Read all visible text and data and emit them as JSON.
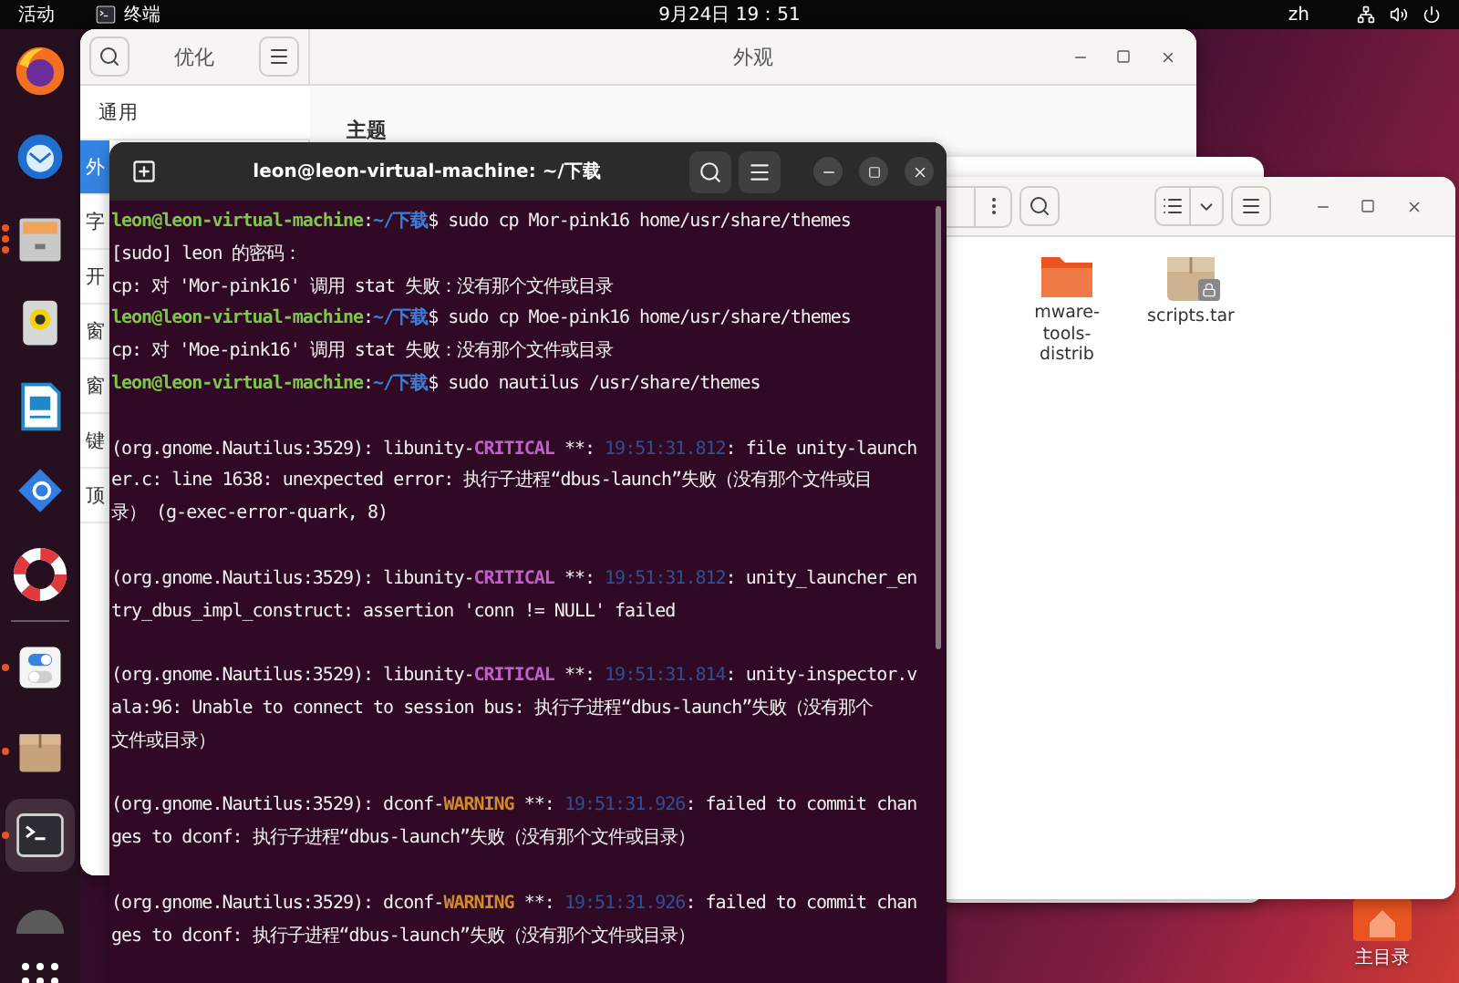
{
  "top_bar": {
    "activities": "活动",
    "app_menu": "终端",
    "clock": "9月24日 19：51",
    "input_method": "zh"
  },
  "dock": {
    "pinned": [
      {
        "kind": "browser",
        "running": false,
        "several_windows": false,
        "selected": false
      },
      {
        "kind": "mail",
        "running": false,
        "several_windows": false,
        "selected": false
      },
      {
        "kind": "files",
        "running": true,
        "several_windows": true,
        "selected": false
      },
      {
        "kind": "speaker",
        "running": false,
        "several_windows": false,
        "selected": false
      },
      {
        "kind": "document",
        "running": false,
        "several_windows": false,
        "selected": false
      },
      {
        "kind": "gear",
        "running": false,
        "several_windows": false,
        "selected": false
      },
      {
        "kind": "lifebuoy",
        "running": false,
        "several_windows": false,
        "selected": false
      }
    ],
    "running": [
      {
        "kind": "toggles",
        "running": true,
        "several_windows": false,
        "selected": false
      },
      {
        "kind": "package",
        "running": true,
        "several_windows": false,
        "selected": false
      },
      {
        "kind": "terminal",
        "running": true,
        "several_windows": false,
        "selected": true
      },
      {
        "kind": "disc",
        "running": false,
        "several_windows": false,
        "selected": false
      }
    ]
  },
  "tweaks_window": {
    "title": "优化",
    "content_title": "外观",
    "section_heading": "主题",
    "sidebar": [
      {
        "label": "通用",
        "selected": false
      },
      {
        "label": "外",
        "selected": true
      },
      {
        "label": "字",
        "selected": false
      },
      {
        "label": "开",
        "selected": false
      },
      {
        "label": "窗",
        "selected": false
      },
      {
        "label": "窗",
        "selected": false
      },
      {
        "label": "键",
        "selected": false
      },
      {
        "label": "顶",
        "selected": false
      }
    ]
  },
  "file_window": {
    "items": [
      {
        "label": "mware-tools-distrib",
        "kind": "folder",
        "locked": false
      },
      {
        "label": "scripts.tar",
        "kind": "archive",
        "locked": true
      }
    ]
  },
  "desktop_icons": [
    {
      "label": "主目录",
      "kind": "home"
    }
  ],
  "terminal": {
    "title": "leon@leon-virtual-machine: ~/下载",
    "blocks": [
      {
        "lines": [
          {
            "segments": [
              {
                "text": "leon@leon-virtual-machine",
                "kind": "user"
              },
              {
                "text": ":",
                "kind": "plain"
              },
              {
                "text": "~/下载",
                "kind": "path"
              },
              {
                "text": "$ sudo cp Mor-pink16 home/usr/share/themes",
                "kind": "plain"
              }
            ]
          },
          {
            "segments": [
              {
                "text": "[sudo] leon 的密码：",
                "kind": "plain"
              }
            ]
          },
          {
            "segments": [
              {
                "text": "cp: 对 'Mor-pink16' 调用 stat 失败：没有那个文件或目录",
                "kind": "plain"
              }
            ]
          },
          {
            "segments": [
              {
                "text": "leon@leon-virtual-machine",
                "kind": "user"
              },
              {
                "text": ":",
                "kind": "plain"
              },
              {
                "text": "~/下载",
                "kind": "path"
              },
              {
                "text": "$ sudo cp Moe-pink16 home/usr/share/themes",
                "kind": "plain"
              }
            ]
          },
          {
            "segments": [
              {
                "text": "cp: 对 'Moe-pink16' 调用 stat 失败：没有那个文件或目录",
                "kind": "plain"
              }
            ]
          },
          {
            "segments": [
              {
                "text": "leon@leon-virtual-machine",
                "kind": "user"
              },
              {
                "text": ":",
                "kind": "plain"
              },
              {
                "text": "~/下载",
                "kind": "path"
              },
              {
                "text": "$ sudo nautilus /usr/share/themes",
                "kind": "plain"
              }
            ]
          }
        ]
      },
      {
        "lines": [
          {
            "segments": [
              {
                "text": "(org.gnome.Nautilus:3529): libunity-",
                "kind": "plain"
              },
              {
                "text": "CRITICAL",
                "kind": "critical"
              },
              {
                "text": " **: ",
                "kind": "plain"
              },
              {
                "text": "19:51:31.812",
                "kind": "time"
              },
              {
                "text": ": file unity-launch",
                "kind": "plain"
              }
            ]
          },
          {
            "segments": [
              {
                "text": "er.c: line 1638: unexpected error: 执行子进程“dbus-launch”失败（没有那个文件或目",
                "kind": "plain"
              }
            ]
          },
          {
            "segments": [
              {
                "text": "录） (g-exec-error-quark, 8)",
                "kind": "plain"
              }
            ]
          }
        ]
      },
      {
        "lines": [
          {
            "segments": [
              {
                "text": "(org.gnome.Nautilus:3529): libunity-",
                "kind": "plain"
              },
              {
                "text": "CRITICAL",
                "kind": "critical"
              },
              {
                "text": " **: ",
                "kind": "plain"
              },
              {
                "text": "19:51:31.812",
                "kind": "time"
              },
              {
                "text": ": unity_launcher_en",
                "kind": "plain"
              }
            ]
          },
          {
            "segments": [
              {
                "text": "try_dbus_impl_construct: assertion 'conn != NULL' failed",
                "kind": "plain"
              }
            ]
          }
        ]
      },
      {
        "lines": [
          {
            "segments": [
              {
                "text": "(org.gnome.Nautilus:3529): libunity-",
                "kind": "plain"
              },
              {
                "text": "CRITICAL",
                "kind": "critical"
              },
              {
                "text": " **: ",
                "kind": "plain"
              },
              {
                "text": "19:51:31.814",
                "kind": "time"
              },
              {
                "text": ": unity-inspector.v",
                "kind": "plain"
              }
            ]
          },
          {
            "segments": [
              {
                "text": "ala:96: Unable to connect to session bus: 执行子进程“dbus-launch”失败（没有那个",
                "kind": "plain"
              }
            ]
          },
          {
            "segments": [
              {
                "text": "文件或目录）",
                "kind": "plain"
              }
            ]
          }
        ]
      },
      {
        "lines": [
          {
            "segments": [
              {
                "text": "(org.gnome.Nautilus:3529): dconf-",
                "kind": "plain"
              },
              {
                "text": "WARNING",
                "kind": "warning"
              },
              {
                "text": " **: ",
                "kind": "plain"
              },
              {
                "text": "19:51:31.926",
                "kind": "time"
              },
              {
                "text": ": failed to commit chan",
                "kind": "plain"
              }
            ]
          },
          {
            "segments": [
              {
                "text": "ges to dconf: 执行子进程“dbus-launch”失败（没有那个文件或目录）",
                "kind": "plain"
              }
            ]
          }
        ]
      },
      {
        "lines": [
          {
            "segments": [
              {
                "text": "(org.gnome.Nautilus:3529): dconf-",
                "kind": "plain"
              },
              {
                "text": "WARNING",
                "kind": "warning"
              },
              {
                "text": " **: ",
                "kind": "plain"
              },
              {
                "text": "19:51:31.926",
                "kind": "time"
              },
              {
                "text": ": failed to commit chan",
                "kind": "plain"
              }
            ]
          },
          {
            "segments": [
              {
                "text": "ges to dconf: 执行子进程“dbus-launch”失败（没有那个文件或目录）",
                "kind": "plain"
              }
            ]
          }
        ]
      }
    ]
  }
}
